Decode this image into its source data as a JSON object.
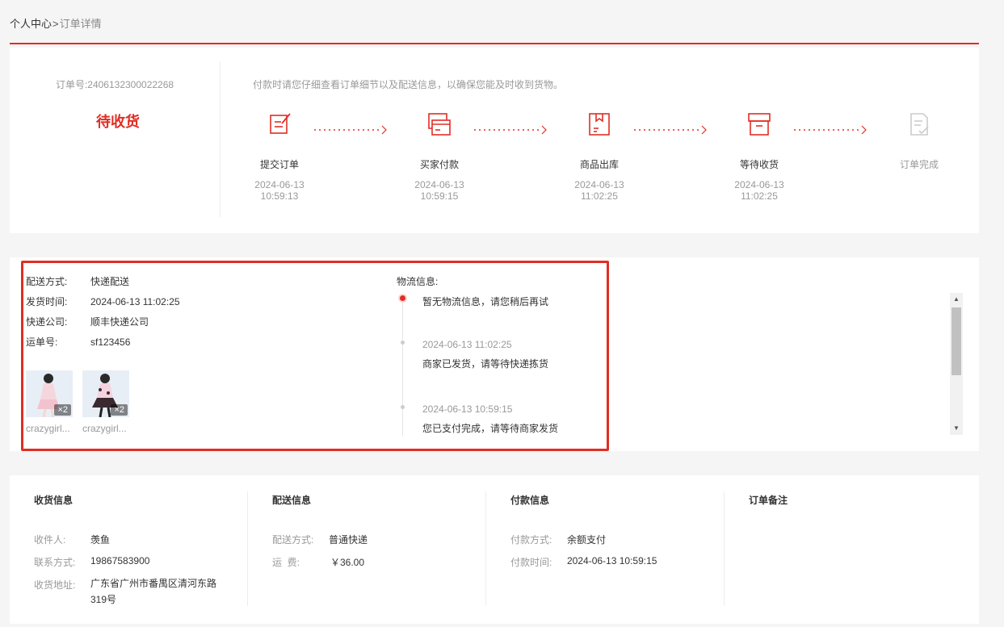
{
  "breadcrumb": {
    "home": "个人中心",
    "sep": ">",
    "current": "订单详情"
  },
  "order": {
    "number_label": "订单号:",
    "number": "2406132300022268",
    "status": "待收货",
    "tip": "付款时请您仔细查看订单细节以及配送信息，以确保您能及时收到货物。"
  },
  "steps": [
    {
      "name": "提交订单",
      "date": "2024-06-13",
      "time": "10:59:13",
      "icon": "edit-document-icon"
    },
    {
      "name": "买家付款",
      "date": "2024-06-13",
      "time": "10:59:15",
      "icon": "wallet-card-icon"
    },
    {
      "name": "商品出库",
      "date": "2024-06-13",
      "time": "11:02:25",
      "icon": "package-box-icon"
    },
    {
      "name": "等待收货",
      "date": "2024-06-13",
      "time": "11:02:25",
      "icon": "archive-box-icon"
    },
    {
      "name": "订单完成",
      "date": "",
      "time": "",
      "icon": "checklist-icon"
    }
  ],
  "shipping": {
    "method_label": "配送方式:",
    "method": "快递配送",
    "ship_time_label": "发货时间:",
    "ship_time": "2024-06-13 11:02:25",
    "company_label": "快递公司:",
    "company": "顺丰快递公司",
    "tracking_label": "运单号:",
    "tracking": "sf123456"
  },
  "products": [
    {
      "name": "crazygirl...",
      "qty": "×2"
    },
    {
      "name": "crazygirl...",
      "qty": "×2"
    }
  ],
  "logistics": {
    "title": "物流信息:",
    "events": [
      {
        "time": "",
        "text": "暂无物流信息，请您稍后再试",
        "active": true
      },
      {
        "time": "2024-06-13 11:02:25",
        "text": "商家已发货，请等待快递拣货",
        "active": false
      },
      {
        "time": "2024-06-13 10:59:15",
        "text": "您已支付完成，请等待商家发货",
        "active": false
      }
    ]
  },
  "receiver": {
    "title": "收货信息",
    "name_label": "收件人:",
    "name": "羡鱼",
    "phone_label": "联系方式:",
    "phone": "19867583900",
    "address_label": "收货地址:",
    "address_line1": "广东省广州市番禺区清河东路",
    "address_line2": "319号"
  },
  "delivery": {
    "title": "配送信息",
    "method_label": "配送方式:",
    "method": "普通快递",
    "fee_label": "运  费:",
    "fee": "￥36.00"
  },
  "payment": {
    "title": "付款信息",
    "method_label": "付款方式:",
    "method": "余额支付",
    "time_label": "付款时间:",
    "time": "2024-06-13 10:59:15"
  },
  "remark": {
    "title": "订单备注"
  },
  "colors": {
    "accent": "#e02e24",
    "muted": "#999999",
    "text": "#333333",
    "done_step": "#cccccc"
  }
}
